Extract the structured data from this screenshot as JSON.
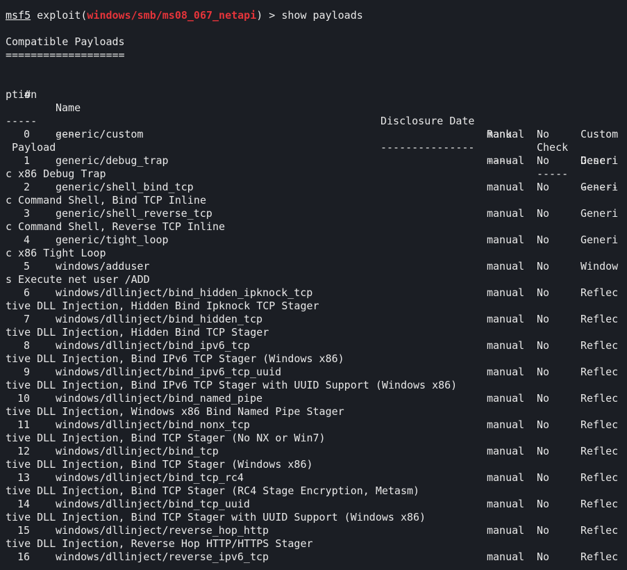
{
  "prompt": {
    "name": "msf5",
    "prefix": " exploit(",
    "module": "windows/smb/ms08_067_netapi",
    "suffix": ") > show payloads"
  },
  "section_title": "Compatible Payloads",
  "section_rule": "===================",
  "table": {
    "headers": {
      "num": "#",
      "name": "Name",
      "date": "Disclosure Date",
      "rank": "Rank",
      "check": "Check",
      "desc_start": "Descri",
      "desc_wrap": "ption"
    },
    "dividers": {
      "num": "-",
      "name": "----",
      "date": "---------------",
      "rank": "----",
      "check": "-----",
      "desc_start": "------",
      "desc_wrap": "-----"
    },
    "rows": [
      {
        "num": "0",
        "name": "generic/custom",
        "rank": "manual",
        "check": "No",
        "desc_start": "Custom",
        "desc_wrap": " Payload"
      },
      {
        "num": "1",
        "name": "generic/debug_trap",
        "rank": "manual",
        "check": "No",
        "desc_start": "Generi",
        "desc_wrap": "c x86 Debug Trap"
      },
      {
        "num": "2",
        "name": "generic/shell_bind_tcp",
        "rank": "manual",
        "check": "No",
        "desc_start": "Generi",
        "desc_wrap": "c Command Shell, Bind TCP Inline"
      },
      {
        "num": "3",
        "name": "generic/shell_reverse_tcp",
        "rank": "manual",
        "check": "No",
        "desc_start": "Generi",
        "desc_wrap": "c Command Shell, Reverse TCP Inline"
      },
      {
        "num": "4",
        "name": "generic/tight_loop",
        "rank": "manual",
        "check": "No",
        "desc_start": "Generi",
        "desc_wrap": "c x86 Tight Loop"
      },
      {
        "num": "5",
        "name": "windows/adduser",
        "rank": "manual",
        "check": "No",
        "desc_start": "Window",
        "desc_wrap": "s Execute net user /ADD"
      },
      {
        "num": "6",
        "name": "windows/dllinject/bind_hidden_ipknock_tcp",
        "rank": "manual",
        "check": "No",
        "desc_start": "Reflec",
        "desc_wrap": "tive DLL Injection, Hidden Bind Ipknock TCP Stager"
      },
      {
        "num": "7",
        "name": "windows/dllinject/bind_hidden_tcp",
        "rank": "manual",
        "check": "No",
        "desc_start": "Reflec",
        "desc_wrap": "tive DLL Injection, Hidden Bind TCP Stager"
      },
      {
        "num": "8",
        "name": "windows/dllinject/bind_ipv6_tcp",
        "rank": "manual",
        "check": "No",
        "desc_start": "Reflec",
        "desc_wrap": "tive DLL Injection, Bind IPv6 TCP Stager (Windows x86)"
      },
      {
        "num": "9",
        "name": "windows/dllinject/bind_ipv6_tcp_uuid",
        "rank": "manual",
        "check": "No",
        "desc_start": "Reflec",
        "desc_wrap": "tive DLL Injection, Bind IPv6 TCP Stager with UUID Support (Windows x86)"
      },
      {
        "num": "10",
        "name": "windows/dllinject/bind_named_pipe",
        "rank": "manual",
        "check": "No",
        "desc_start": "Reflec",
        "desc_wrap": "tive DLL Injection, Windows x86 Bind Named Pipe Stager"
      },
      {
        "num": "11",
        "name": "windows/dllinject/bind_nonx_tcp",
        "rank": "manual",
        "check": "No",
        "desc_start": "Reflec",
        "desc_wrap": "tive DLL Injection, Bind TCP Stager (No NX or Win7)"
      },
      {
        "num": "12",
        "name": "windows/dllinject/bind_tcp",
        "rank": "manual",
        "check": "No",
        "desc_start": "Reflec",
        "desc_wrap": "tive DLL Injection, Bind TCP Stager (Windows x86)"
      },
      {
        "num": "13",
        "name": "windows/dllinject/bind_tcp_rc4",
        "rank": "manual",
        "check": "No",
        "desc_start": "Reflec",
        "desc_wrap": "tive DLL Injection, Bind TCP Stager (RC4 Stage Encryption, Metasm)"
      },
      {
        "num": "14",
        "name": "windows/dllinject/bind_tcp_uuid",
        "rank": "manual",
        "check": "No",
        "desc_start": "Reflec",
        "desc_wrap": "tive DLL Injection, Bind TCP Stager with UUID Support (Windows x86)"
      },
      {
        "num": "15",
        "name": "windows/dllinject/reverse_hop_http",
        "rank": "manual",
        "check": "No",
        "desc_start": "Reflec",
        "desc_wrap": "tive DLL Injection, Reverse Hop HTTP/HTTPS Stager"
      },
      {
        "num": "16",
        "name": "windows/dllinject/reverse_ipv6_tcp",
        "rank": "manual",
        "check": "No",
        "desc_start": "Reflec",
        "desc_wrap": ""
      }
    ]
  },
  "colors": {
    "background": "#1b1e24",
    "text": "#e8e8e8",
    "module": "#e5343a"
  }
}
